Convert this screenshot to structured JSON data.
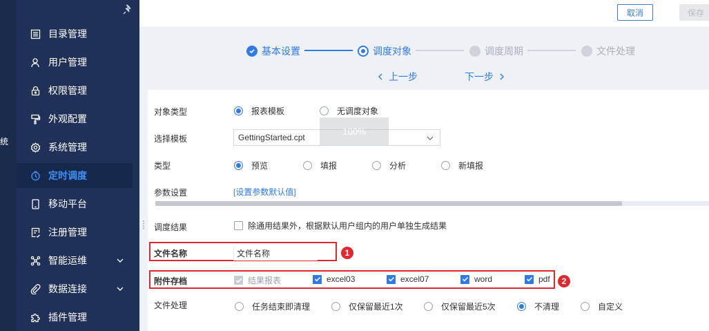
{
  "sidebar": {
    "cut_label": "统",
    "items": [
      {
        "label": "目录管理",
        "icon": "list-icon"
      },
      {
        "label": "用户管理",
        "icon": "user-icon"
      },
      {
        "label": "权限管理",
        "icon": "lock-icon"
      },
      {
        "label": "外观配置",
        "icon": "brush-icon"
      },
      {
        "label": "系统管理",
        "icon": "gear-icon"
      },
      {
        "label": "定时调度",
        "icon": "clock-icon",
        "active": true
      },
      {
        "label": "移动平台",
        "icon": "mobile-icon"
      },
      {
        "label": "注册管理",
        "icon": "register-icon"
      },
      {
        "label": "智能运维",
        "icon": "network-icon",
        "expandable": true
      },
      {
        "label": "数据连接",
        "icon": "link-icon",
        "expandable": true
      },
      {
        "label": "插件管理",
        "icon": "puzzle-icon"
      }
    ]
  },
  "toolbar": {
    "cancel_label": "取消",
    "save_label": "保存"
  },
  "stepper": {
    "steps": [
      {
        "label": "基本设置",
        "state": "done"
      },
      {
        "label": "调度对象",
        "state": "current"
      },
      {
        "label": "调度周期",
        "state": "todo"
      },
      {
        "label": "文件处理",
        "state": "todo"
      }
    ],
    "prev_label": "上一步",
    "next_label": "下一步"
  },
  "form": {
    "object_type": {
      "label": "对象类型",
      "options": [
        "报表模板",
        "无调度对象"
      ],
      "selected": 0
    },
    "template": {
      "label": "选择模板",
      "value": "GettingStarted.cpt"
    },
    "zoom_tip": "100%",
    "type": {
      "label": "类型",
      "options": [
        "预览",
        "填报",
        "分析",
        "新填报"
      ],
      "selected": 0
    },
    "params": {
      "label": "参数设置",
      "link": "[设置参数默认值]"
    },
    "result": {
      "label": "调度结果",
      "checkbox_text": "除通用结果外，根据默认用户组内的用户单独生成结果",
      "checked": false
    },
    "file_name": {
      "label": "文件名称",
      "value": "文件名称",
      "badge": "1"
    },
    "attachment": {
      "label": "附件存档",
      "badge": "2",
      "options": [
        {
          "label": "结果报表",
          "checked": true,
          "disabled": true
        },
        {
          "label": "excel03",
          "checked": true
        },
        {
          "label": "excel07",
          "checked": true
        },
        {
          "label": "word",
          "checked": true
        },
        {
          "label": "pdf",
          "checked": true
        }
      ]
    },
    "file_handling": {
      "label": "文件处理",
      "options": [
        "任务结束即清理",
        "仅保留最近1次",
        "仅保留最近5次",
        "不清理",
        "自定义"
      ],
      "selected": 3
    }
  },
  "colors": {
    "accent": "#2f7ae5",
    "sidebar": "#1f3158",
    "highlight": "#e0282e"
  }
}
